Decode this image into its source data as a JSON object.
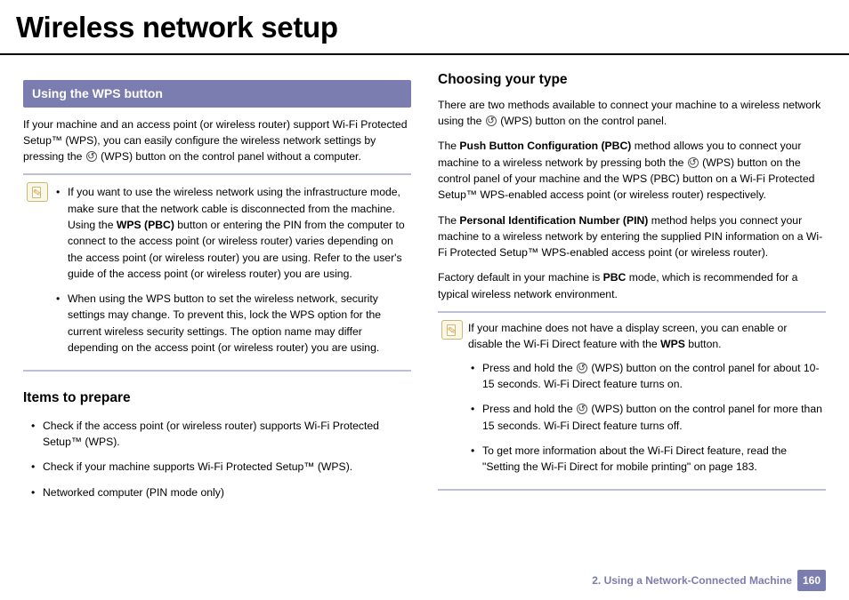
{
  "title": "Wireless network setup",
  "left": {
    "section_bar": "Using the WPS button",
    "intro_a": "If your machine and an access point (or wireless router) support Wi-Fi Protected Setup™ (WPS), you can easily configure the wireless network settings by pressing the ",
    "intro_b": " (WPS) button on the control panel without a computer.",
    "note1_item1_a": "If you want to use the wireless network using the infrastructure mode, make sure that the network cable is disconnected from the machine. Using the ",
    "note1_item1_bold": "WPS (PBC)",
    "note1_item1_b": " button or entering the PIN from the computer to connect to the access point (or wireless router) varies depending on the access point (or wireless router) you are using. Refer to the user's guide of the access point (or wireless router) you are using.",
    "note1_item2": "When using the WPS button to set the wireless network, security settings may change. To prevent this, lock the WPS option for the current wireless security settings. The option name may differ depending on the access point (or wireless router) you are using.",
    "items_head": "Items to prepare",
    "items": [
      "Check if the access point (or wireless router) supports Wi-Fi Protected Setup™ (WPS).",
      "Check if your machine supports Wi-Fi Protected Setup™ (WPS).",
      "Networked computer (PIN mode only)"
    ]
  },
  "right": {
    "heading": "Choosing your type",
    "p1a": "There are two methods available to connect your machine to a wireless network using the ",
    "p1b": " (WPS) button on the control panel.",
    "p2a": "The ",
    "p2bold": "Push Button Configuration (PBC)",
    "p2b": " method allows you to connect your machine to a wireless network by pressing both the ",
    "p2c": " (WPS) button on the control panel of your machine and the WPS (PBC) button on a Wi-Fi Protected Setup™ WPS-enabled access point (or wireless router) respectively.",
    "p3a": "The ",
    "p3bold": "Personal Identification Number (PIN)",
    "p3b": " method helps you connect your machine to a wireless network by entering the supplied PIN information on a Wi-Fi Protected Setup™ WPS-enabled access point (or wireless router).",
    "p4a": "Factory default in your machine is ",
    "p4bold": "PBC",
    "p4b": " mode, which is recommended for a typical wireless network environment.",
    "note2_lead_a": "If your machine does not have a display screen, you can enable or disable the Wi-Fi Direct feature with the ",
    "note2_lead_bold": "WPS",
    "note2_lead_b": " button.",
    "note2_i1a": "Press and hold the ",
    "note2_i1b": " (WPS) button on the control panel for about 10-15 seconds. Wi-Fi Direct feature turns on.",
    "note2_i2a": "Press and hold the ",
    "note2_i2b": " (WPS) button on the control panel for more than 15 seconds. Wi-Fi Direct feature turns off.",
    "note2_i3": "To get more information about the Wi-Fi Direct feature, read the \"Setting the Wi-Fi Direct for mobile printing\" on page 183."
  },
  "footer": {
    "chapter": "2.  Using a Network-Connected Machine",
    "page": "160"
  }
}
